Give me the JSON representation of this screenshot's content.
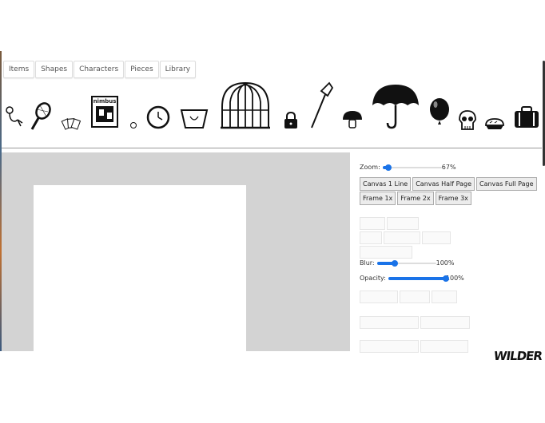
{
  "tabs": [
    "Items",
    "Shapes",
    "Characters",
    "Pieces",
    "Library"
  ],
  "shelf_items": [
    "stethoscope-icon",
    "tennis-racket-icon",
    "playing-cards-icon",
    "nimbus-box-icon",
    "small-circle-icon",
    "clock-icon",
    "basket-icon",
    "birdcage-icon",
    "padlock-icon",
    "broom-icon",
    "mushroom-icon",
    "umbrella-icon",
    "balloon-icon",
    "skull-icon",
    "pie-icon",
    "suitcase-icon"
  ],
  "nimbus_box_text": "nimbus",
  "controls": {
    "zoom_label": "Zoom:",
    "zoom_value": 0.67,
    "zoom_text": "67%",
    "canvas_buttons": [
      "Canvas 1 Line",
      "Canvas Half Page",
      "Canvas Full Page"
    ],
    "frame_buttons": [
      "Frame 1x",
      "Frame 2x",
      "Frame 3x"
    ],
    "blur_label": "Blur:",
    "blur_value": 1.0,
    "blur_text": "100%",
    "opacity_label": "Opacity:",
    "opacity_value": 1.0,
    "opacity_text": "100%"
  },
  "logo_text": "WILDER",
  "colors": {
    "accent": "#1a73e8",
    "canvas_bg": "#d3d3d3"
  }
}
